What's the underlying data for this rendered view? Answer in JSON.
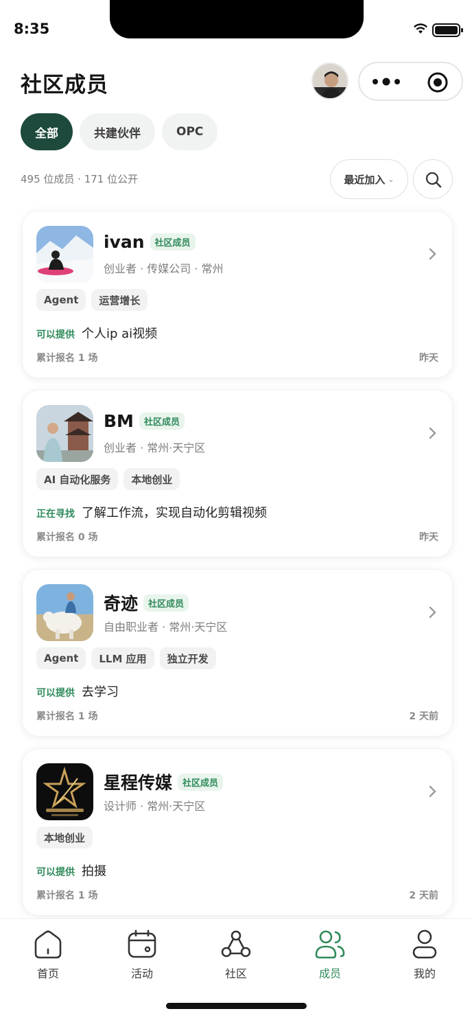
{
  "status_bar": {
    "time": "8:35"
  },
  "header": {
    "title": "社区成员"
  },
  "filters": {
    "tabs": [
      {
        "label": "全部",
        "active": true
      },
      {
        "label": "共建伙伴",
        "active": false
      },
      {
        "label": "OPC",
        "active": false
      }
    ]
  },
  "summary": {
    "count_text": "495 位成员 · 171 位公开"
  },
  "sort": {
    "label": "最近加入"
  },
  "members": [
    {
      "name": "ivan",
      "badge": "社区成员",
      "subtitle": "创业者 · 传媒公司 · 常州",
      "tags": [
        "Agent",
        "运营增长"
      ],
      "intent_label": "可以提供",
      "intent_text": "个人ip ai视频",
      "signups": "累计报名 1 场",
      "time": "昨天"
    },
    {
      "name": "BM",
      "badge": "社区成员",
      "subtitle": "创业者 · 常州·天宁区",
      "tags": [
        "AI 自动化服务",
        "本地创业"
      ],
      "intent_label": "正在寻找",
      "intent_text": "了解工作流，实现自动化剪辑视频",
      "signups": "累计报名 0 场",
      "time": "昨天"
    },
    {
      "name": "奇迹",
      "badge": "社区成员",
      "subtitle": "自由职业者 · 常州·天宁区",
      "tags": [
        "Agent",
        "LLM 应用",
        "独立开发"
      ],
      "intent_label": "可以提供",
      "intent_text": "去学习",
      "signups": "累计报名 1 场",
      "time": "2 天前"
    },
    {
      "name": "星程传媒",
      "badge": "社区成员",
      "subtitle": "设计师 · 常州·天宁区",
      "tags": [
        "本地创业"
      ],
      "intent_label": "可以提供",
      "intent_text": "拍摄",
      "signups": "累计报名 1 场",
      "time": "2 天前"
    }
  ],
  "tab_bar": {
    "items": [
      {
        "label": "首页",
        "icon": "home-icon"
      },
      {
        "label": "活动",
        "icon": "calendar-icon"
      },
      {
        "label": "社区",
        "icon": "community-icon"
      },
      {
        "label": "成员",
        "icon": "members-icon",
        "active": true
      },
      {
        "label": "我的",
        "icon": "profile-icon"
      }
    ]
  },
  "colors": {
    "primary": "#1d4a3c",
    "accent_green": "#2f8a5a",
    "badge_bg": "#e8f4ec"
  }
}
